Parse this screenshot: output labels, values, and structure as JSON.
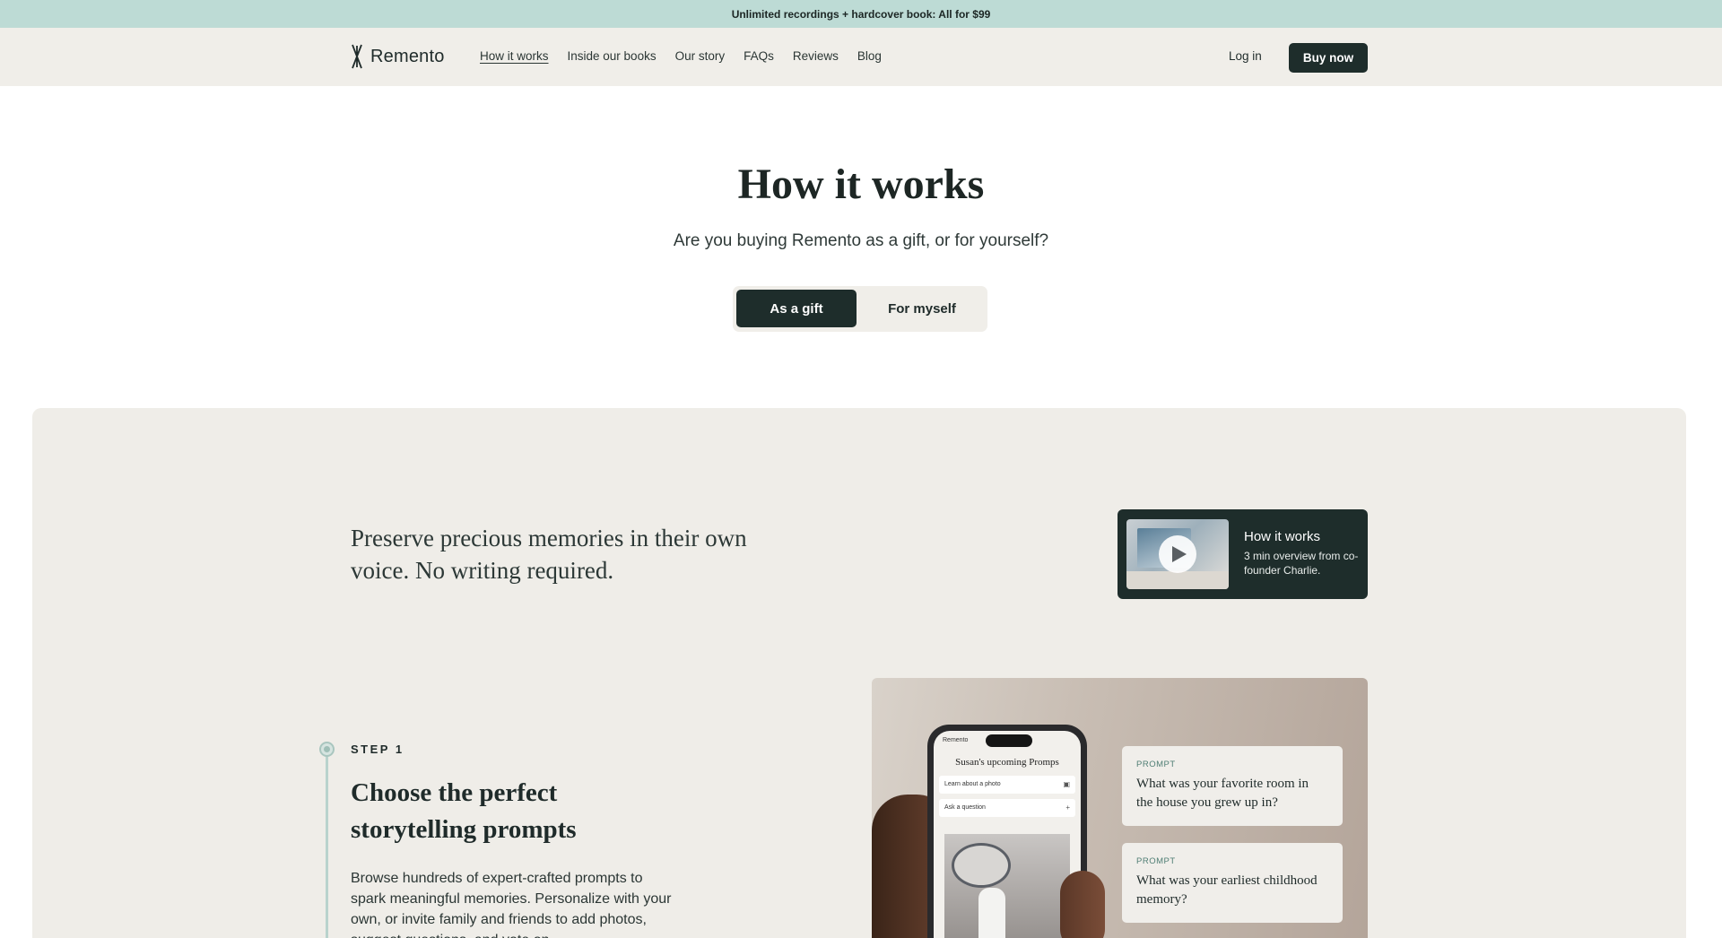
{
  "promo": {
    "text": "Unlimited recordings + hardcover book: All for $99"
  },
  "nav": {
    "logo_text": "Remento",
    "links": [
      "How it works",
      "Inside our books",
      "Our story",
      "FAQs",
      "Reviews",
      "Blog"
    ],
    "active_index": 0,
    "login_label": "Log in",
    "buy_label": "Buy now"
  },
  "hero": {
    "title": "How it works",
    "subtitle": "Are you buying Remento as a gift, or for yourself?",
    "toggle": {
      "gift_label": "As a gift",
      "self_label": "For myself",
      "selected": "As a gift"
    }
  },
  "section": {
    "tagline": "Preserve precious memories in their own voice. No writing required.",
    "video": {
      "title": "How it works",
      "description": "3 min overview from co-founder Charlie."
    },
    "step": {
      "label": "STEP 1",
      "title": "Choose the perfect storytelling prompts",
      "description": "Browse hundreds of expert-crafted prompts to spark meaningful memories. Personalize with your own, or invite family and friends to add photos, suggest questions, and vote on"
    },
    "phone": {
      "app_name": "Remento",
      "heading": "Susan's upcoming Promps",
      "rows": [
        "Learn about a photo",
        "Ask a question"
      ]
    },
    "prompts": [
      {
        "label": "PROMPT",
        "text": "What was your favorite room in the house you grew up in?"
      },
      {
        "label": "PROMPT",
        "text": "What was your earliest childhood memory?"
      }
    ]
  },
  "colors": {
    "promo_bg": "#bddbd5",
    "nav_bg": "#f0eee9",
    "primary_dark": "#1e2d2b",
    "panel_bg": "#efede8",
    "accent_teal": "#4f7e74"
  },
  "icons": {
    "logo": "remento-logo-mark",
    "play": "play-icon"
  }
}
